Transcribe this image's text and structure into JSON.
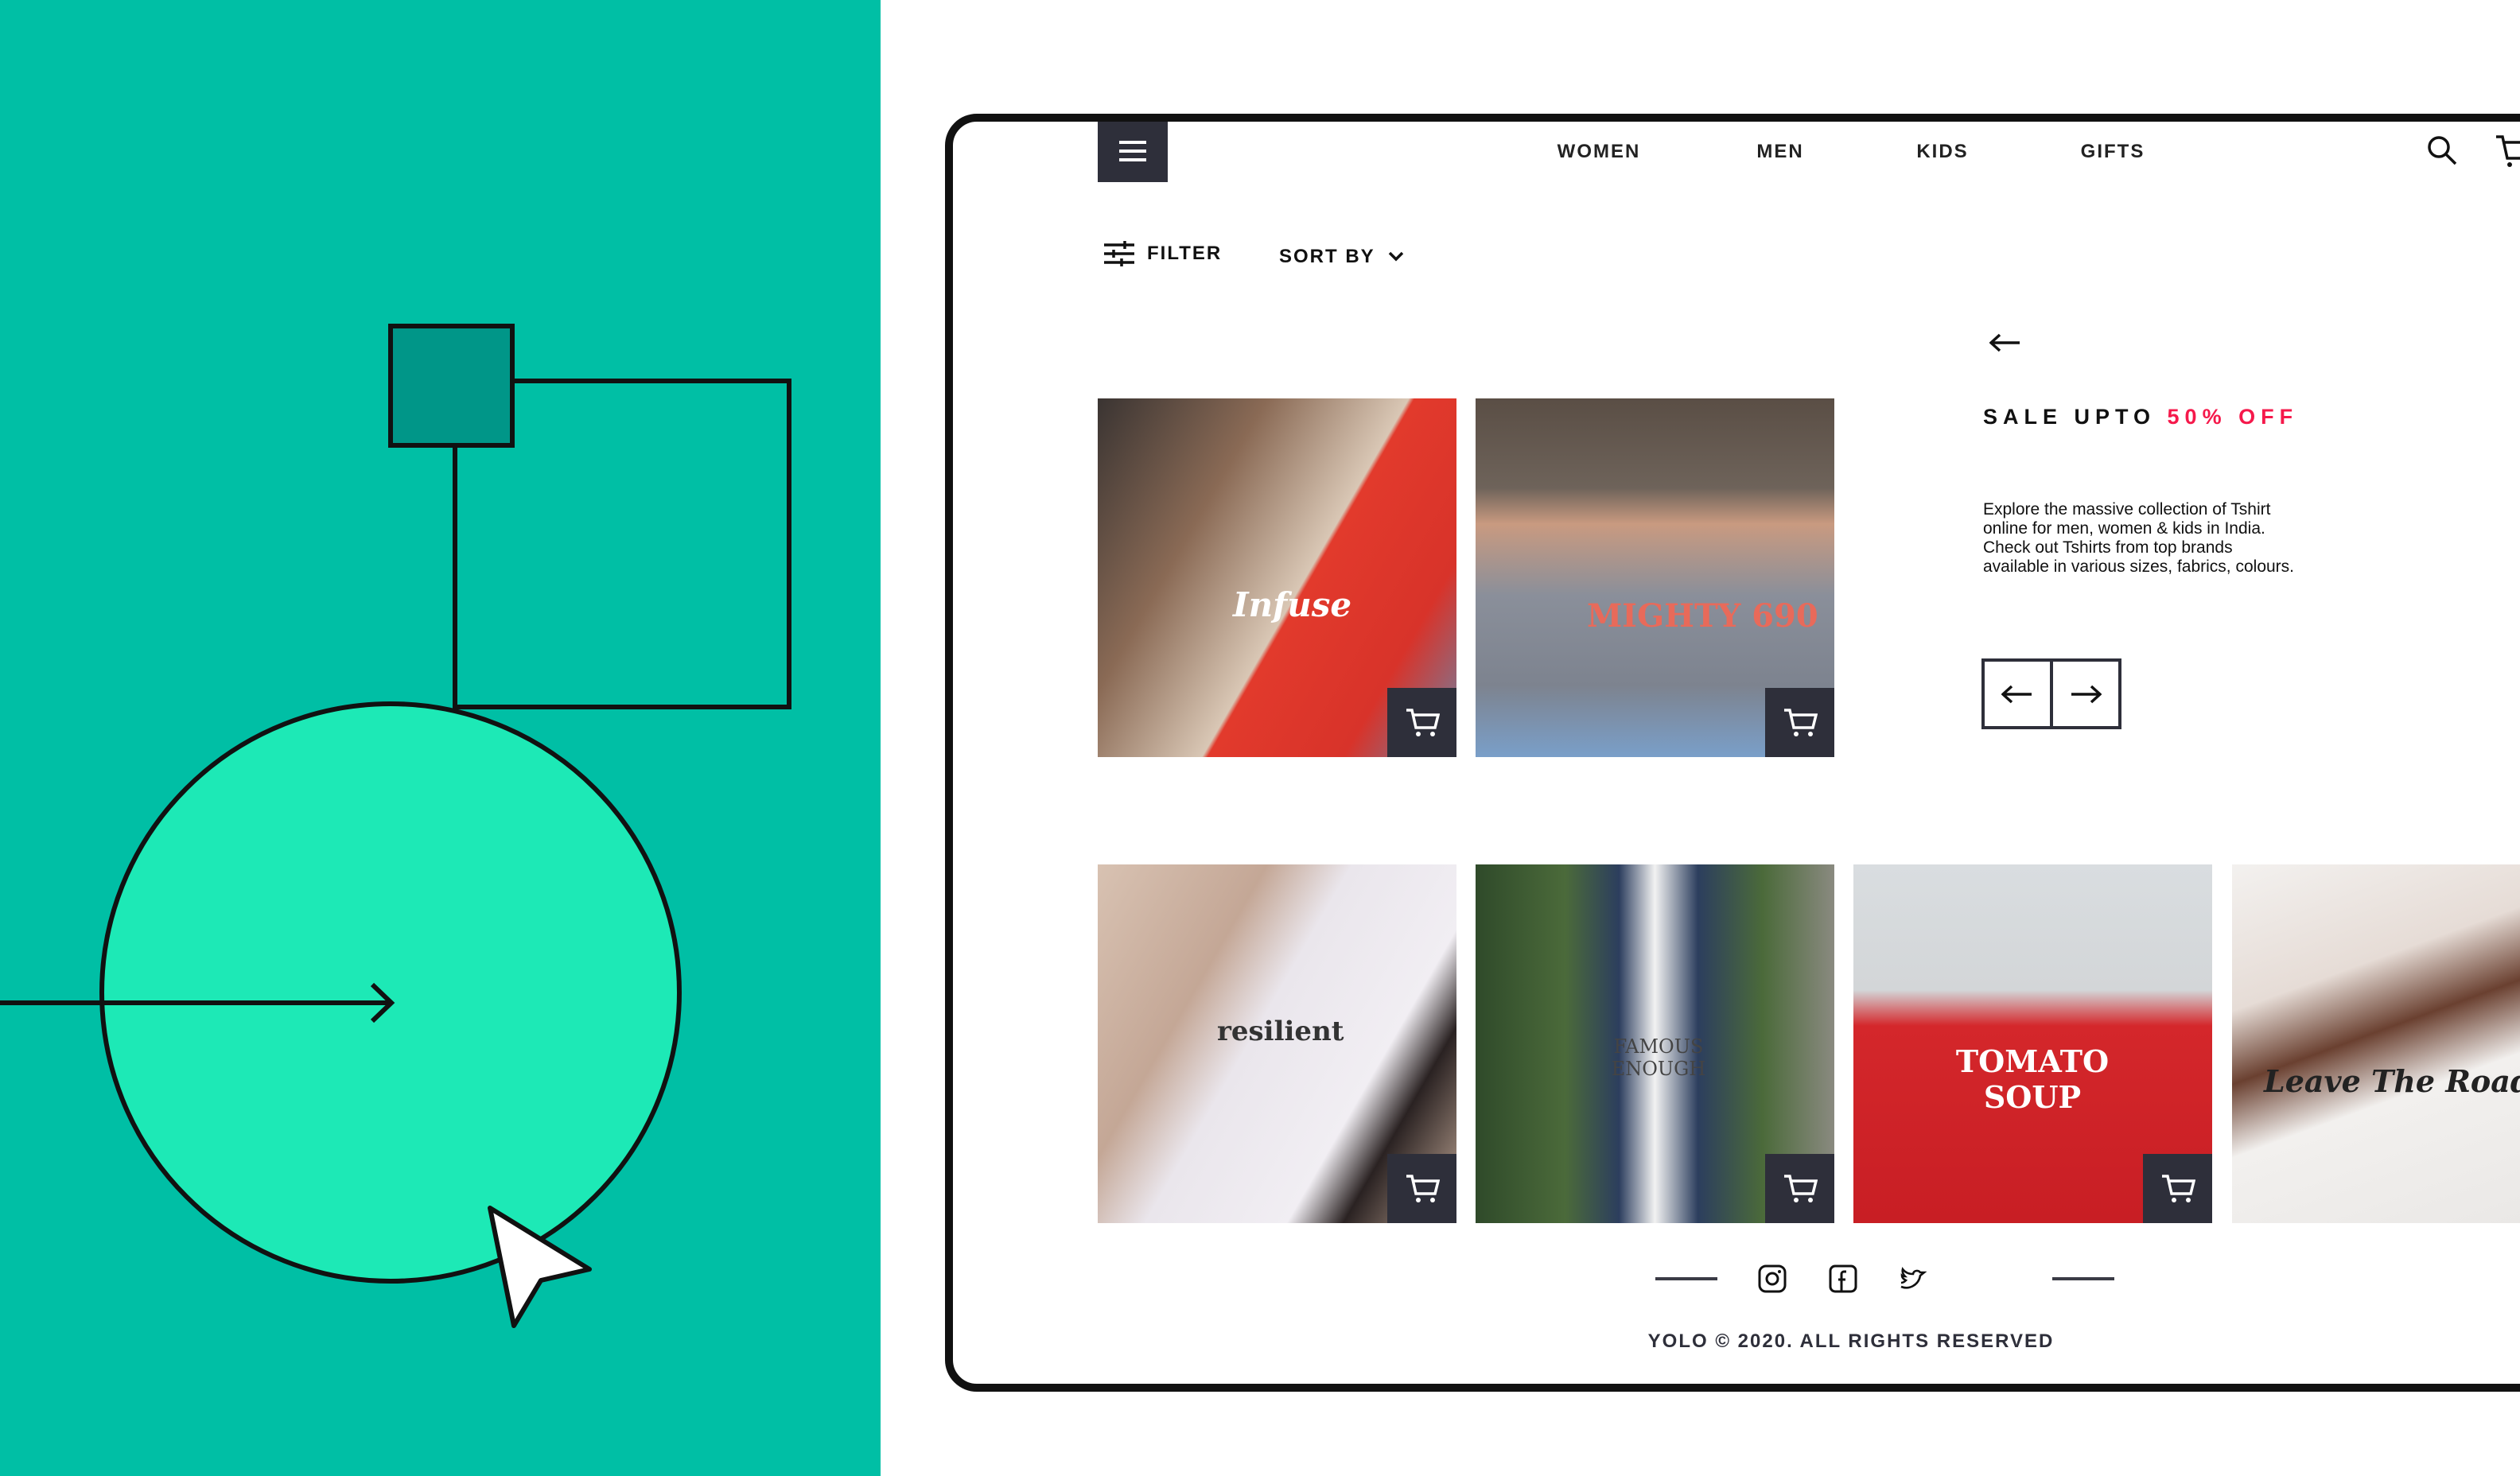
{
  "colors": {
    "teal": "#00BFA5",
    "mint": "#1DE9B6",
    "dark": "#2E2F3A",
    "accent": "#F5194B"
  },
  "nav": {
    "items": [
      {
        "label": "WOMEN"
      },
      {
        "label": "MEN"
      },
      {
        "label": "KIDS"
      },
      {
        "label": "GIFTS"
      }
    ],
    "icons": [
      "menu-icon",
      "search-icon",
      "cart-icon"
    ]
  },
  "toolbar": {
    "filter_label": "FILTER",
    "sort_label": "SORT BY"
  },
  "promo": {
    "title": "SALE UPTO ",
    "highlight": "50% OFF",
    "description": "Explore the massive collection of Tshirt online for men, women & kids in India. Check out Tshirts from top brands available in various sizes, fabrics, colours."
  },
  "products": [
    {
      "print": "Infuse"
    },
    {
      "print": "MIGHTY 690"
    },
    {
      "print": "resilient"
    },
    {
      "print": "FAMOUS ENOUGH"
    },
    {
      "print": "TOMATO SOUP"
    },
    {
      "print": "Leave The Road"
    }
  ],
  "footer": {
    "social": [
      "instagram-icon",
      "facebook-icon",
      "twitter-icon"
    ],
    "copyright": "YOLO © 2020. ALL RIGHTS RESERVED"
  }
}
